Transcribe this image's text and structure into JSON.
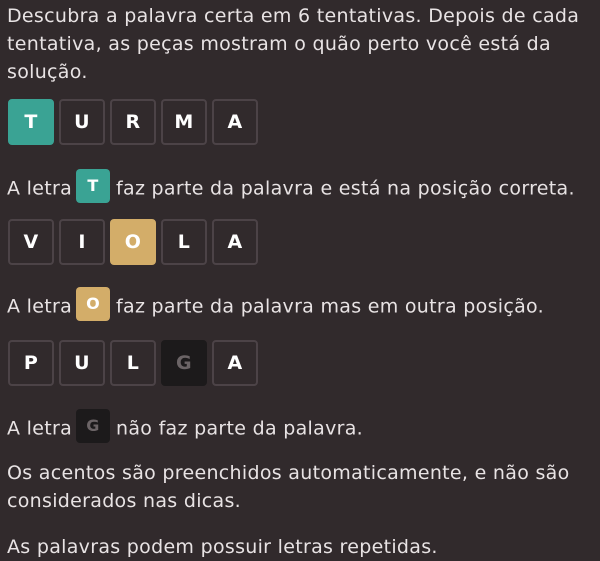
{
  "intro": {
    "line1": "Descubra a palavra certa em 6 tentativas. Depois de cada",
    "line2": "tentativa, as peças mostram o quão perto você está da",
    "line3": "solução."
  },
  "examples": [
    {
      "tiles": [
        "T",
        "U",
        "R",
        "M",
        "A"
      ],
      "states": [
        "correct",
        "empty",
        "empty",
        "empty",
        "empty"
      ],
      "text_before": "A letra",
      "letter": "T",
      "text_after": "faz parte da palavra e está na posição correta."
    },
    {
      "tiles": [
        "V",
        "I",
        "O",
        "L",
        "A"
      ],
      "states": [
        "empty",
        "empty",
        "present",
        "empty",
        "empty"
      ],
      "text_before": "A letra",
      "letter": "O",
      "text_after": "faz parte da palavra mas em outra posição."
    },
    {
      "tiles": [
        "P",
        "U",
        "L",
        "G",
        "A"
      ],
      "states": [
        "empty",
        "empty",
        "empty",
        "absent",
        "empty"
      ],
      "text_before": "A letra",
      "letter": "G",
      "text_after": "não faz parte da palavra."
    }
  ],
  "notes": {
    "accents_line1": "Os acentos são preenchidos automaticamente, e não são",
    "accents_line2": "considerados nas dicas.",
    "repeats": "As palavras podem possuir letras repetidas."
  },
  "colors": {
    "background": "#312a2c",
    "correct": "#3aa394",
    "present": "#d3ad69",
    "absent": "#1c1a1b",
    "border": "#4c4347"
  }
}
